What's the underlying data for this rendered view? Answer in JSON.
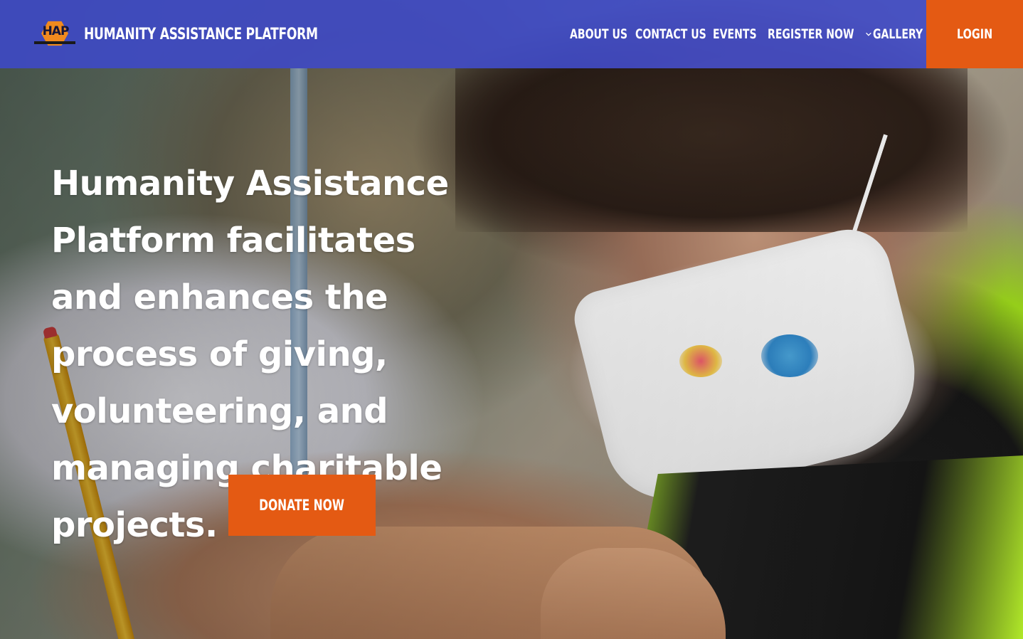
{
  "header": {
    "logo_text": "HAP",
    "brand_name": "HUMANITY ASSISTANCE PLATFORM",
    "nav": [
      {
        "label": "ABOUT US"
      },
      {
        "label": "CONTACT US"
      },
      {
        "label": "EVENTS"
      },
      {
        "label": "REGISTER NOW",
        "has_dropdown": true
      },
      {
        "label": "GALLERY"
      }
    ],
    "login_label": "LOGIN"
  },
  "hero": {
    "headline": "Humanity Assistance Platform facilitates and enhances the process of giving, volunteering, and managing charitable projects.",
    "donate_label": "DONATE NOW"
  },
  "colors": {
    "header_bg": "#3d49c9",
    "accent": "#e45a13",
    "text": "#ffffff"
  },
  "icons": {
    "register_dropdown": "chevron-down-icon",
    "logo": "hap-logo-icon"
  }
}
